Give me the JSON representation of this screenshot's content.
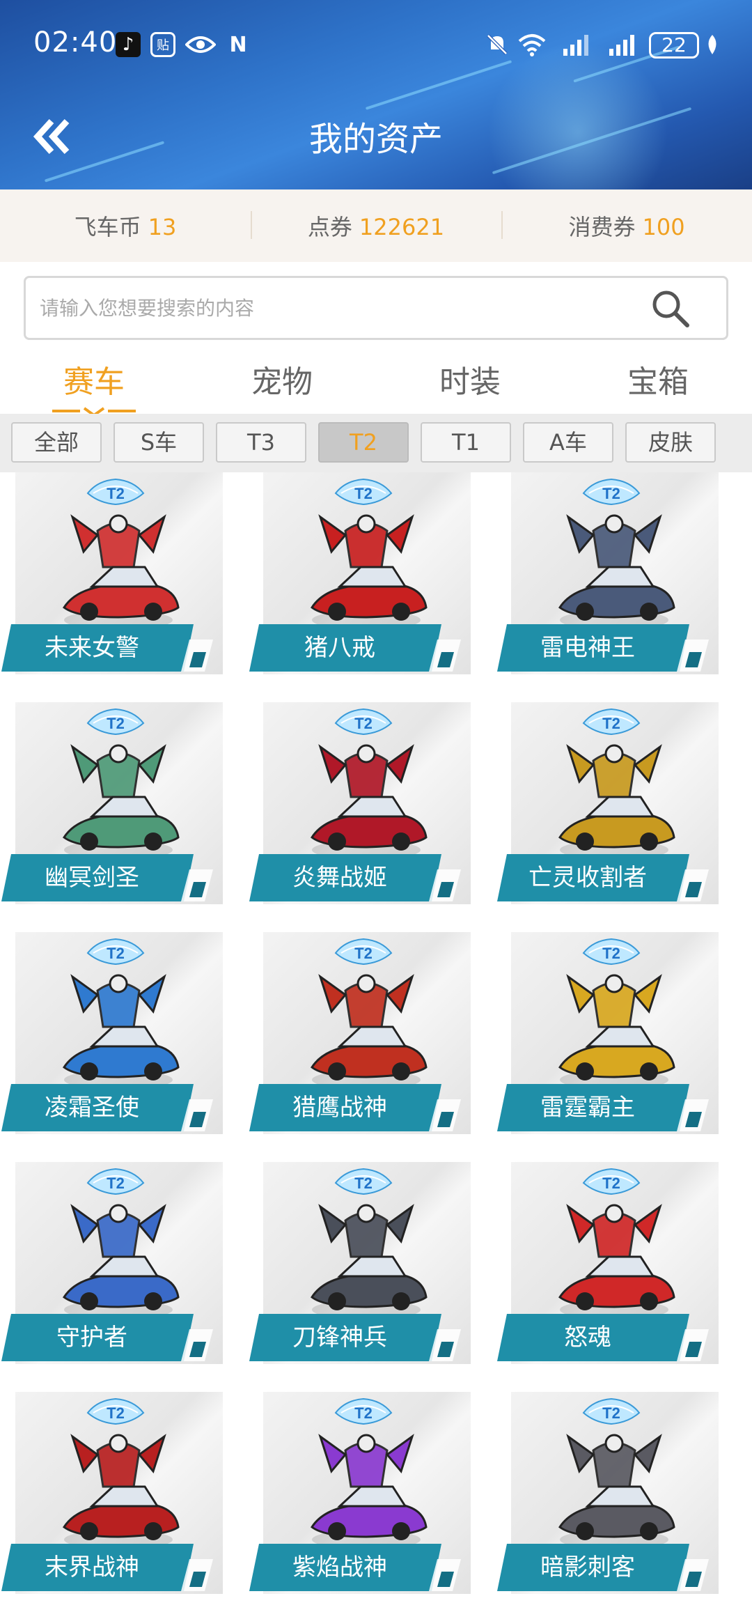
{
  "status_bar": {
    "time": "02:40",
    "battery": "22"
  },
  "header": {
    "title": "我的资产"
  },
  "currencies": [
    {
      "label": "飞车币",
      "value": "13"
    },
    {
      "label": "点券",
      "value": "122621"
    },
    {
      "label": "消费券",
      "value": "100"
    }
  ],
  "search": {
    "placeholder": "请输入您想要搜索的内容"
  },
  "category_tabs": [
    {
      "label": "赛车",
      "active": true
    },
    {
      "label": "宠物",
      "active": false
    },
    {
      "label": "时装",
      "active": false
    },
    {
      "label": "宝箱",
      "active": false
    }
  ],
  "filters": [
    {
      "label": "全部",
      "active": false
    },
    {
      "label": "S车",
      "active": false
    },
    {
      "label": "T3",
      "active": false
    },
    {
      "label": "T2",
      "active": true
    },
    {
      "label": "T1",
      "active": false
    },
    {
      "label": "A车",
      "active": false
    },
    {
      "label": "皮肤",
      "active": false
    }
  ],
  "colors": {
    "accent": "#f0a020",
    "plate": "#1f8fa8",
    "plate_dark": "#146e84"
  },
  "items": [
    {
      "name": "未来女警",
      "tier": "T2",
      "color": "#d03030"
    },
    {
      "name": "猪八戒",
      "tier": "T2",
      "color": "#c82020"
    },
    {
      "name": "雷电神王",
      "tier": "T2",
      "color": "#4a5a7a"
    },
    {
      "name": "幽冥剑圣",
      "tier": "T2",
      "color": "#4f9a78"
    },
    {
      "name": "炎舞战姬",
      "tier": "T2",
      "color": "#b01828"
    },
    {
      "name": "亡灵收割者",
      "tier": "T2",
      "color": "#c89a20"
    },
    {
      "name": "凌霜圣使",
      "tier": "T2",
      "color": "#2f7ad0"
    },
    {
      "name": "猎鹰战神",
      "tier": "T2",
      "color": "#c03020"
    },
    {
      "name": "雷霆霸主",
      "tier": "T2",
      "color": "#d8a820"
    },
    {
      "name": "守护者",
      "tier": "T2",
      "color": "#3a6ac8"
    },
    {
      "name": "刀锋神兵",
      "tier": "T2",
      "color": "#4a4f5a"
    },
    {
      "name": "怒魂",
      "tier": "T2",
      "color": "#d02828"
    },
    {
      "name": "末界战神",
      "tier": "T2",
      "color": "#b82020"
    },
    {
      "name": "紫焰战神",
      "tier": "T2",
      "color": "#8a3ad0"
    },
    {
      "name": "暗影刺客",
      "tier": "T2",
      "color": "#5a5a62"
    }
  ]
}
